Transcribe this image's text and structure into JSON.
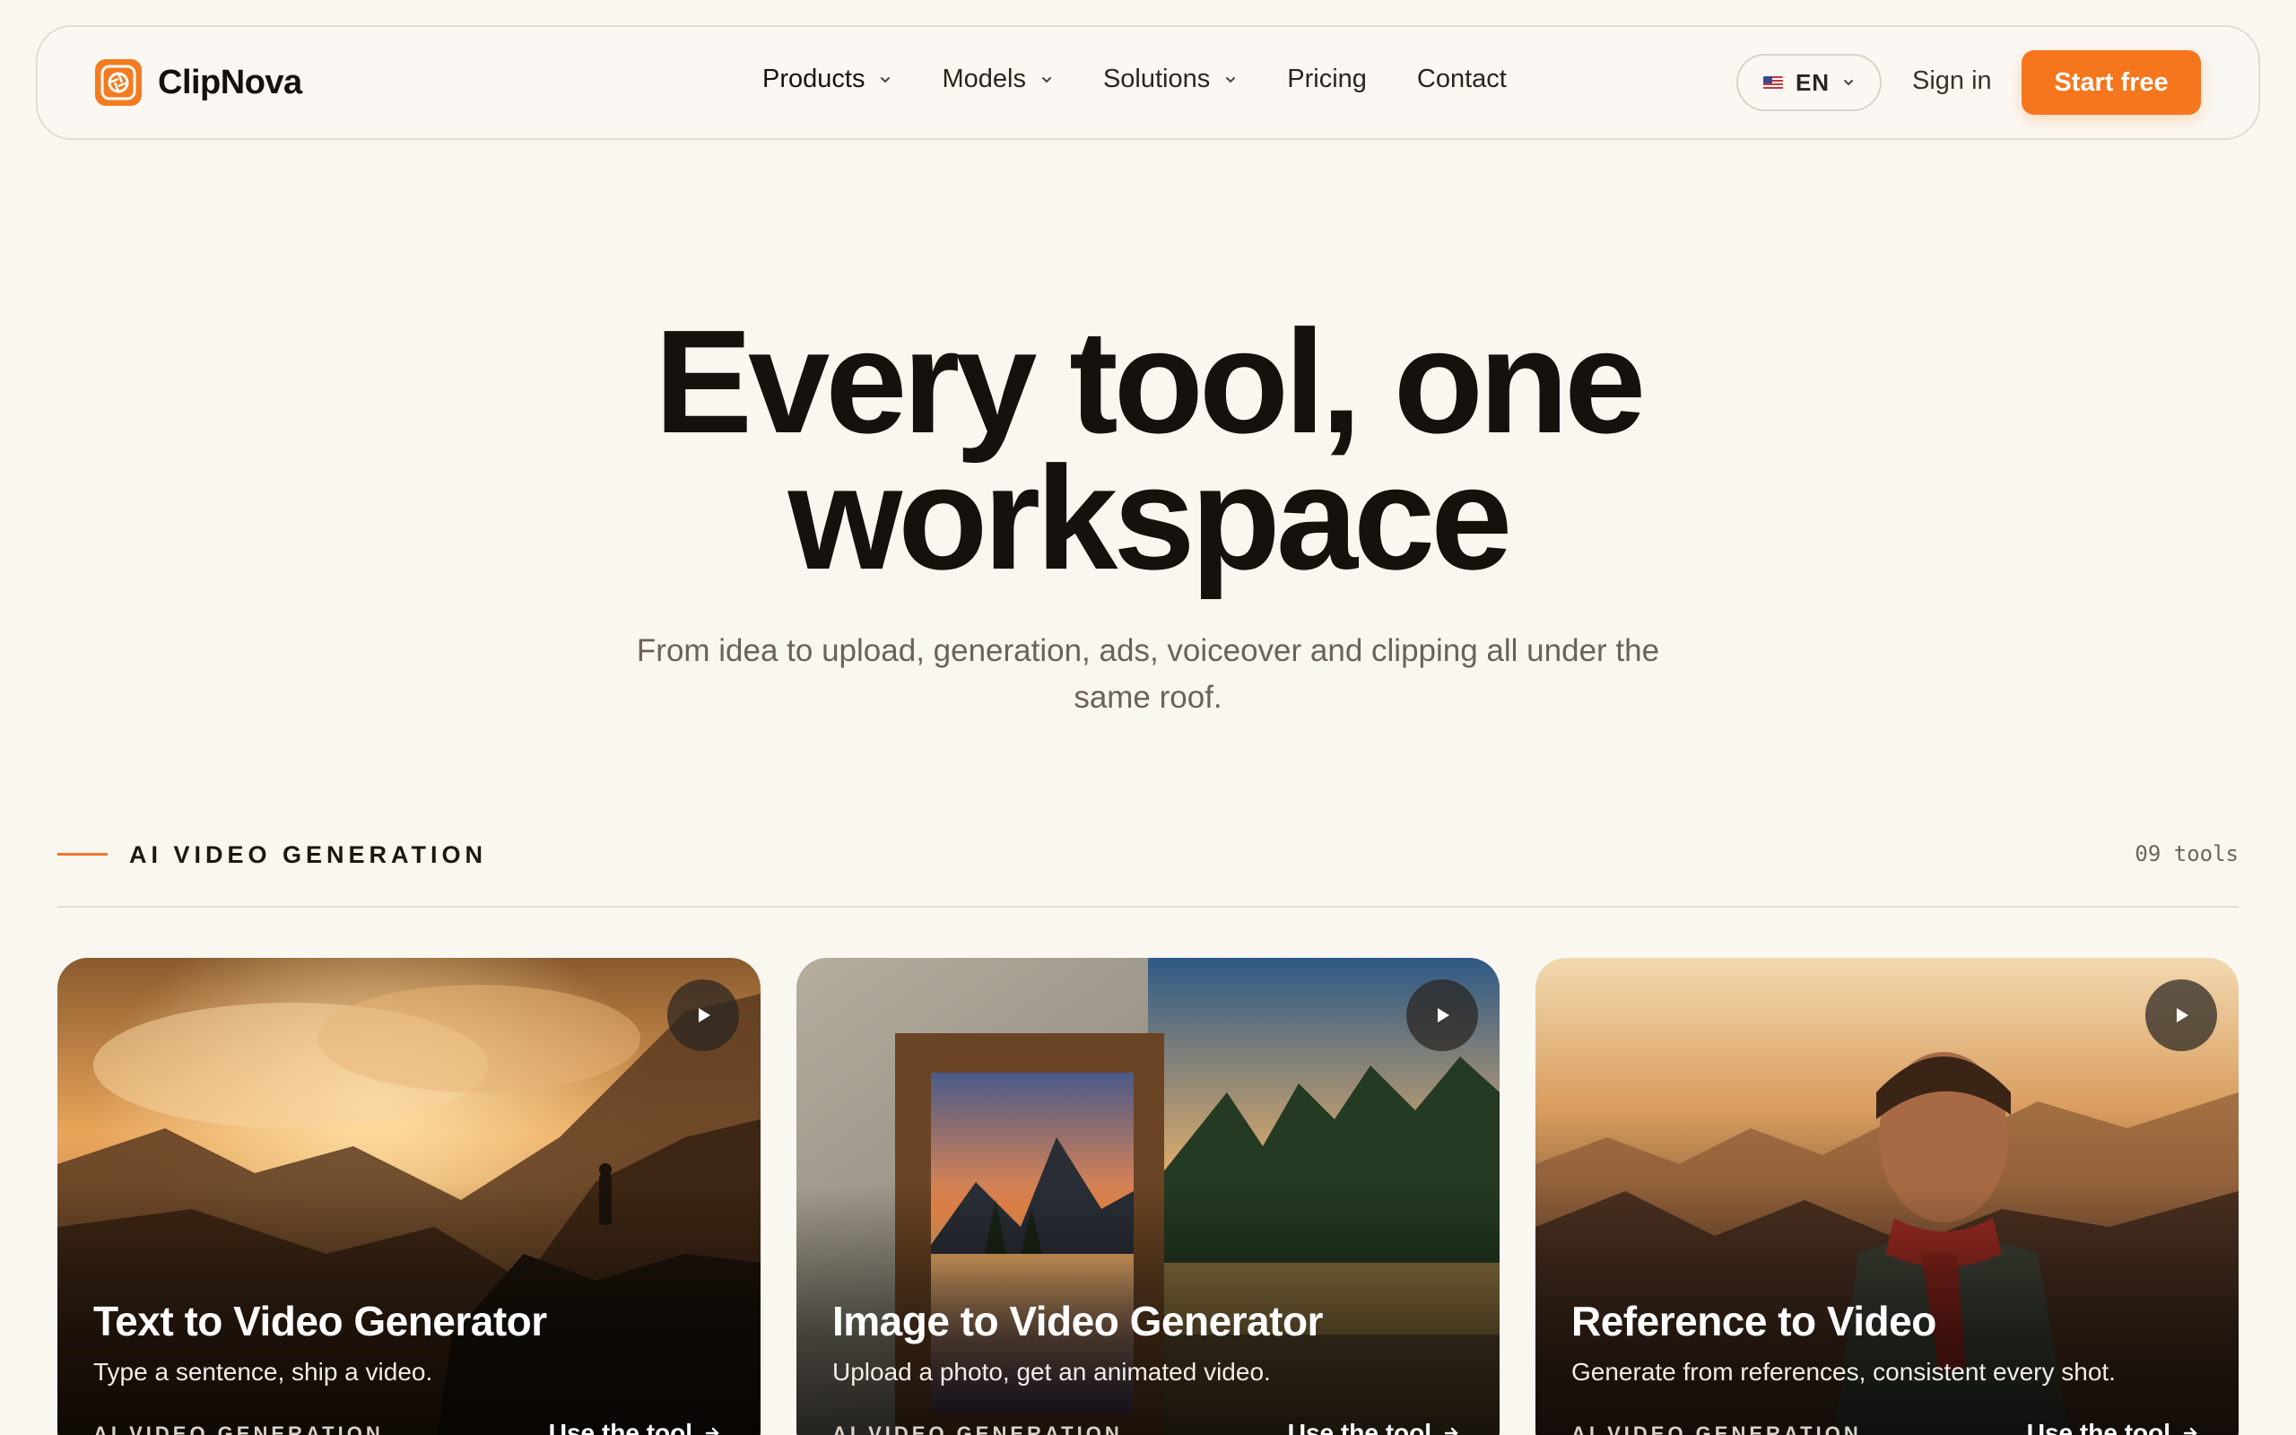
{
  "brand": {
    "name": "ClipNova",
    "accent": "#f5761d"
  },
  "nav": {
    "items": [
      {
        "label": "Products",
        "dropdown": true
      },
      {
        "label": "Models",
        "dropdown": true
      },
      {
        "label": "Solutions",
        "dropdown": true
      },
      {
        "label": "Pricing",
        "dropdown": false
      },
      {
        "label": "Contact",
        "dropdown": false
      }
    ],
    "language": "EN",
    "sign_in": "Sign in",
    "start": "Start free"
  },
  "hero": {
    "title_line1": "Every tool, one",
    "title_line2": "workspace",
    "subtitle": "From idea to upload, generation, ads, voiceover and clipping all under the same roof."
  },
  "section": {
    "title": "AI VIDEO GENERATION",
    "count": "09 tools"
  },
  "cards": [
    {
      "title": "Text to Video Generator",
      "description": "Type a sentence, ship a video.",
      "tag": "AI VIDEO GENERATION",
      "cta": "Use the tool"
    },
    {
      "title": "Image to Video Generator",
      "description": "Upload a photo, get an animated video.",
      "tag": "AI VIDEO GENERATION",
      "cta": "Use the tool"
    },
    {
      "title": "Reference to Video",
      "description": "Generate from references, consistent every shot.",
      "tag": "AI VIDEO GENERATION",
      "cta": "Use the tool"
    }
  ]
}
